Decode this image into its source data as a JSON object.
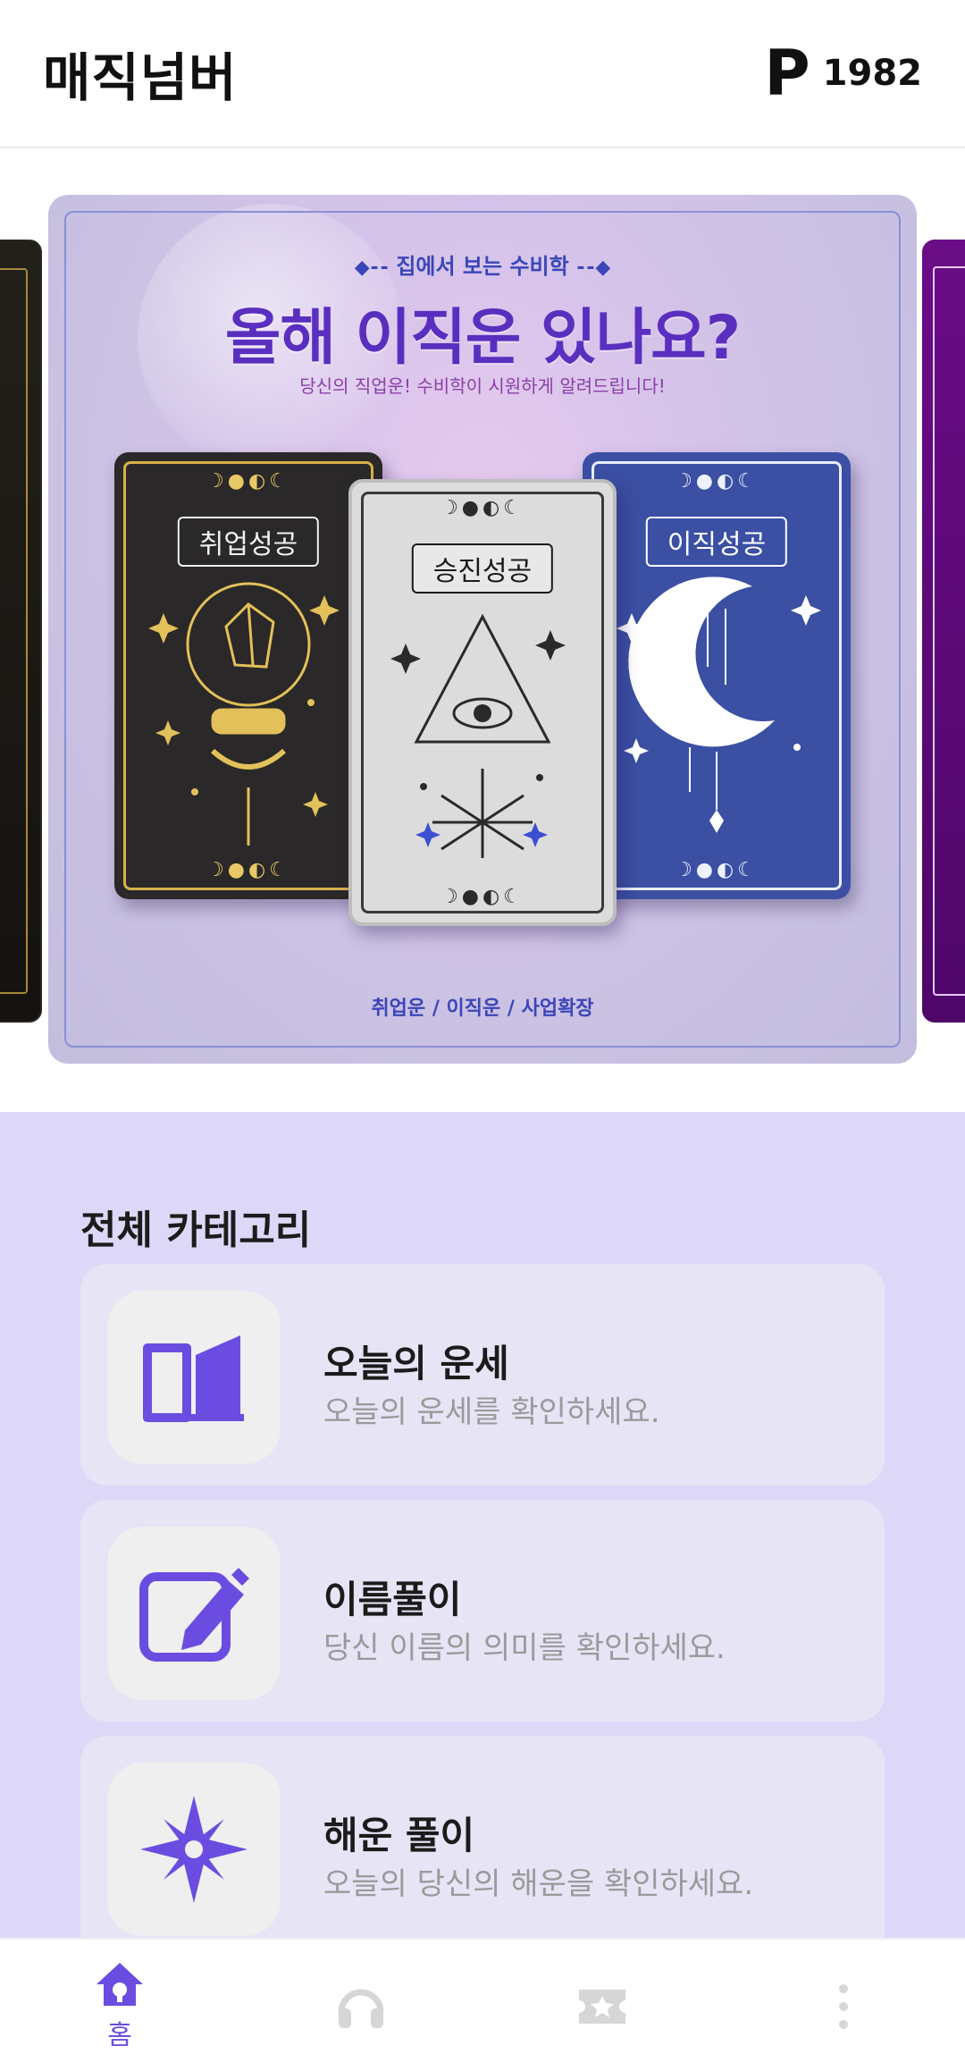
{
  "header": {
    "app_title": "매직넘버",
    "points_icon": "P",
    "points_value": "1982"
  },
  "banner": {
    "kicker": "집에서 보는 수비학",
    "headline": "올해 이직운 있나요?",
    "subtitle": "당신의 직업운! 수비학이 시원하게 알려드립니다!",
    "cards": [
      {
        "label": "취업성공",
        "icon": "crystal-ball-icon"
      },
      {
        "label": "승진성공",
        "icon": "eye-pyramid-icon"
      },
      {
        "label": "이직성공",
        "icon": "crescent-moon-icon"
      }
    ],
    "moon_phases": "☽●◐☾",
    "tags": "취업운 / 이직운 / 사업확장"
  },
  "categories": {
    "section_title": "전체 카테고리",
    "items": [
      {
        "title": "오늘의 운세",
        "desc": "오늘의 운세를 확인하세요.",
        "icon": "open-book-icon"
      },
      {
        "title": "이름풀이",
        "desc": "당신 이름의 의미를 확인하세요.",
        "icon": "edit-pencil-icon"
      },
      {
        "title": "해운 풀이",
        "desc": "오늘의 당신의 해운을 확인하세요.",
        "icon": "compass-star-icon"
      }
    ]
  },
  "bottom_nav": {
    "items": [
      {
        "label": "홈",
        "icon": "home-icon",
        "active": true
      },
      {
        "label": "",
        "icon": "headset-icon",
        "active": false
      },
      {
        "label": "",
        "icon": "ticket-star-icon",
        "active": false
      },
      {
        "label": "",
        "icon": "more-vertical-icon",
        "active": false
      }
    ]
  },
  "colors": {
    "accent": "#6a4de0",
    "category_bg": "#ddd8f8",
    "inactive_icon": "#d6d6d6"
  }
}
